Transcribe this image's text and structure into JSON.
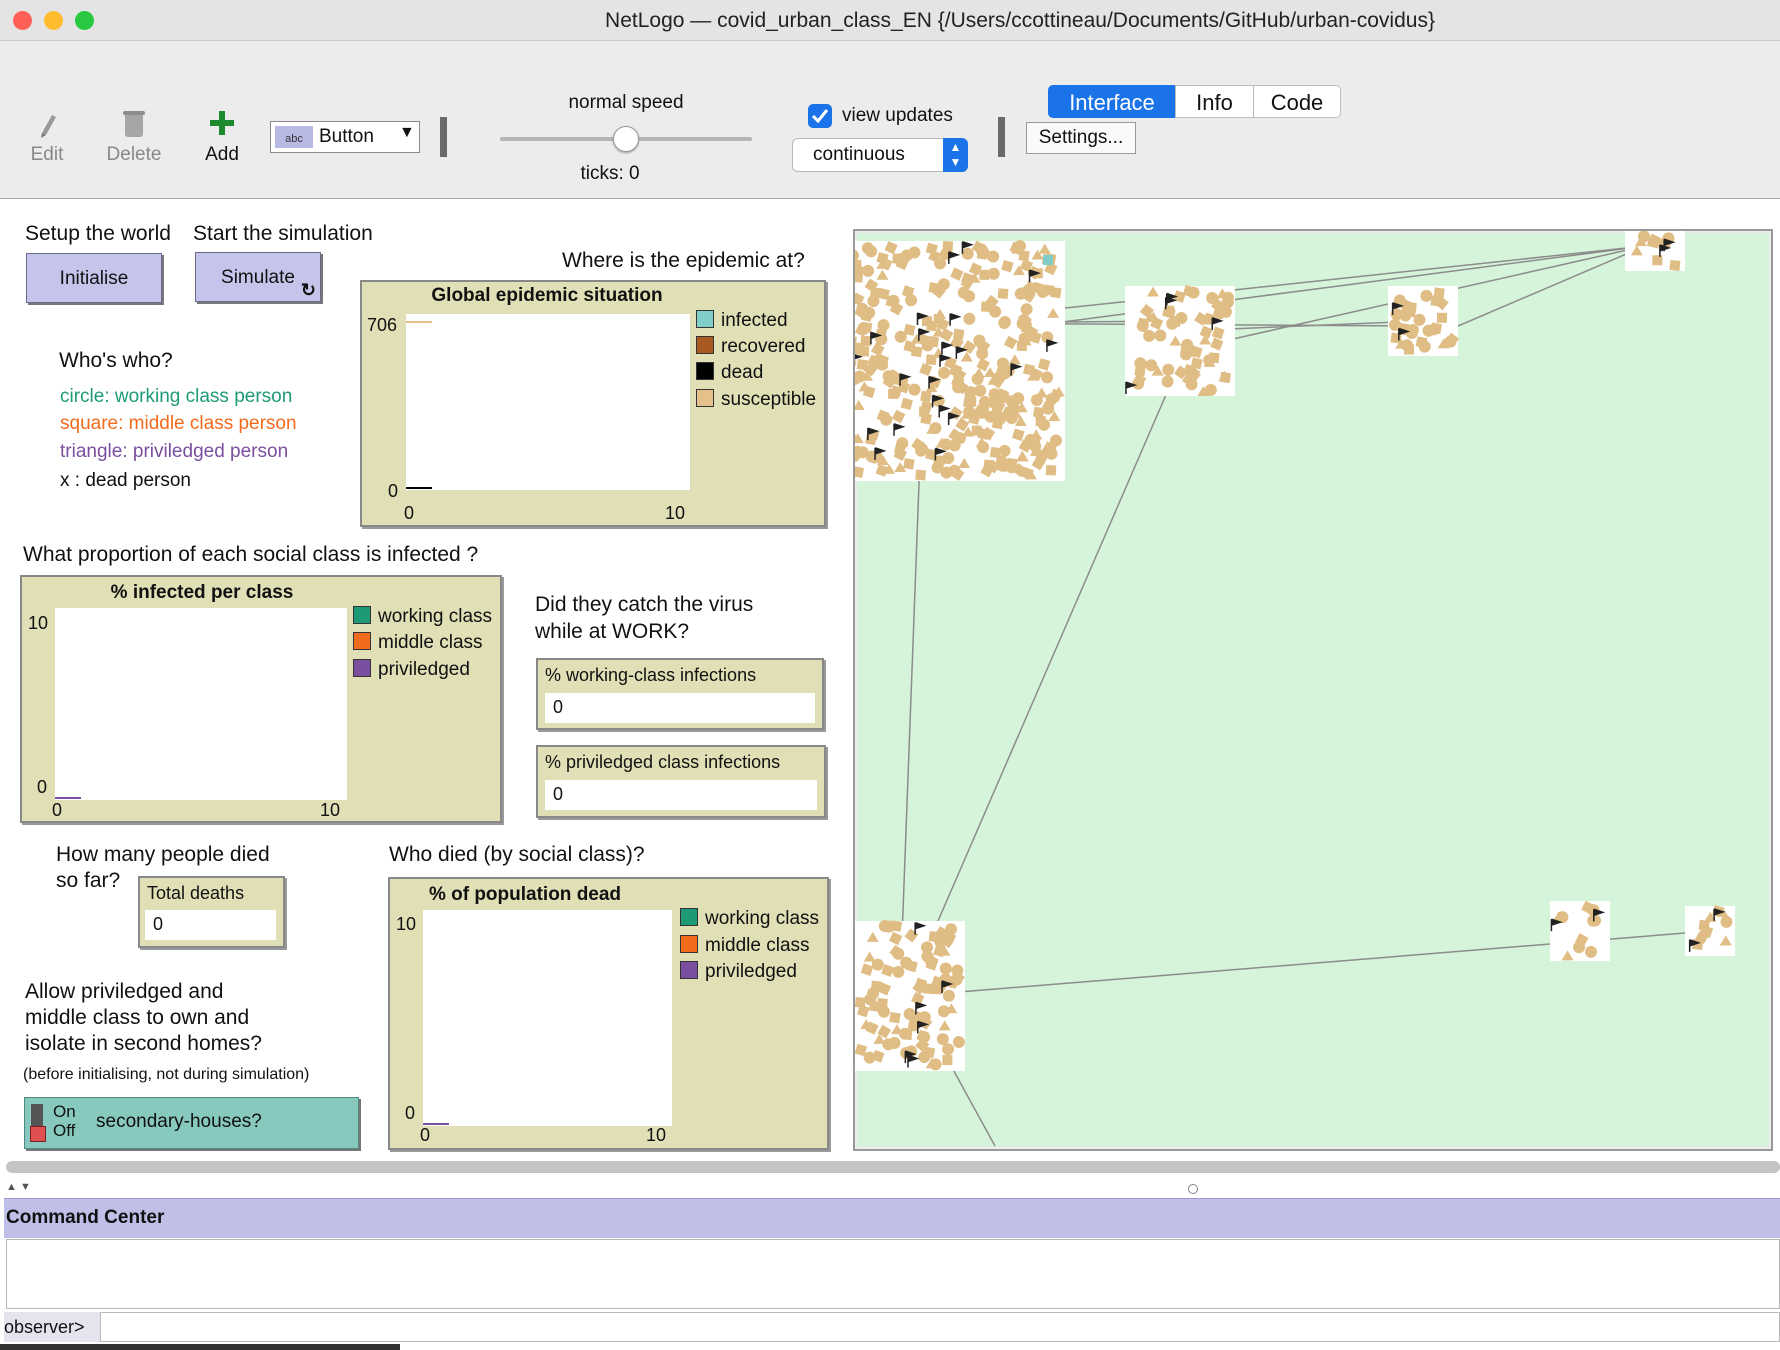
{
  "window": {
    "title": "NetLogo — covid_urban_class_EN {/Users/ccottineau/Documents/GitHub/urban-covidus}",
    "tabs": [
      "Interface",
      "Info",
      "Code"
    ],
    "active_tab": "Interface"
  },
  "toolbar": {
    "edit": "Edit",
    "delete": "Delete",
    "add": "Add",
    "widget_type": "Button",
    "widget_type_icon": "abc",
    "speed_label": "normal speed",
    "ticks": "ticks: 0",
    "view_updates": "view updates",
    "view_updates_checked": true,
    "update_mode": "continuous",
    "settings": "Settings..."
  },
  "left": {
    "setup_label": "Setup the world",
    "start_label": "Start the simulation",
    "initialise_button": "Initialise",
    "simulate_button": "Simulate",
    "whos_who": "Who's who?",
    "legend_circle": "circle: working class person",
    "legend_square": "square: middle class person",
    "legend_triangle": "triangle: priviledged person",
    "legend_x": "x : dead person",
    "where_epidemic": "Where is the epidemic at?",
    "proportion_q": "What proportion of each social class is infected ?",
    "work_q_1": "Did they catch the virus",
    "work_q_2": "while at WORK?",
    "died_q_1": "How many people died",
    "died_q_2": "so far?",
    "who_died": "Who died (by social class)?",
    "second_homes_1": "Allow priviledged and",
    "second_homes_2": "middle class to own and",
    "second_homes_3": "isolate in second homes?",
    "second_homes_note": "(before initialising, not during simulation)",
    "switch_on": "On",
    "switch_off": "Off",
    "switch_label": "secondary-houses?"
  },
  "monitors": {
    "working_label": "% working-class infections",
    "working_value": "0",
    "priv_label": "% priviledged class infections",
    "priv_value": "0",
    "deaths_label": "Total deaths",
    "deaths_value": "0"
  },
  "chart_data": [
    {
      "type": "line",
      "title": "Global epidemic situation",
      "xlim": [
        0,
        10
      ],
      "ylim": [
        0,
        706
      ],
      "x_ticks": [
        "0",
        "10"
      ],
      "y_ticks": [
        "0",
        "706"
      ],
      "series": [
        {
          "name": "infected",
          "color": "#7fcfc8",
          "values": [
            [
              0,
              0
            ]
          ]
        },
        {
          "name": "recovered",
          "color": "#a85a20",
          "values": [
            [
              0,
              0
            ]
          ]
        },
        {
          "name": "dead",
          "color": "#000000",
          "values": [
            [
              0,
              0
            ]
          ]
        },
        {
          "name": "susceptible",
          "color": "#e6c08a",
          "values": [
            [
              0,
              706
            ]
          ]
        }
      ]
    },
    {
      "type": "line",
      "title": "% infected per class",
      "xlim": [
        0,
        10
      ],
      "ylim": [
        0,
        10
      ],
      "x_ticks": [
        "0",
        "10"
      ],
      "y_ticks": [
        "0",
        "10"
      ],
      "series": [
        {
          "name": "working class",
          "color": "#1f9a77",
          "values": [
            [
              0,
              0
            ]
          ]
        },
        {
          "name": "middle class",
          "color": "#f26b1d",
          "values": [
            [
              0,
              0
            ]
          ]
        },
        {
          "name": "priviledged",
          "color": "#7b4fa0",
          "values": [
            [
              0,
              0
            ]
          ]
        }
      ]
    },
    {
      "type": "line",
      "title": "% of population dead",
      "xlim": [
        0,
        10
      ],
      "ylim": [
        0,
        10
      ],
      "x_ticks": [
        "0",
        "10"
      ],
      "y_ticks": [
        "0",
        "10"
      ],
      "series": [
        {
          "name": "working class",
          "color": "#1f9a77",
          "values": [
            [
              0,
              0
            ]
          ]
        },
        {
          "name": "middle class",
          "color": "#f26b1d",
          "values": [
            [
              0,
              0
            ]
          ]
        },
        {
          "name": "priviledged",
          "color": "#7b4fa0",
          "values": [
            [
              0,
              0
            ]
          ]
        }
      ]
    }
  ],
  "colors": {
    "button_fill": "#c5c5ec",
    "plot_fill": "#e0dfb6",
    "switch_fill": "#88c9bf",
    "world_background": "#d6f4d9",
    "agent": "#dfbd84",
    "command_center": "#c0bfe8",
    "legend_working": "#1f9a77",
    "legend_middle": "#f26b1d",
    "legend_priviledged": "#7b4fa0"
  },
  "command_center": {
    "title": "Command Center",
    "prompt": "observer>"
  }
}
